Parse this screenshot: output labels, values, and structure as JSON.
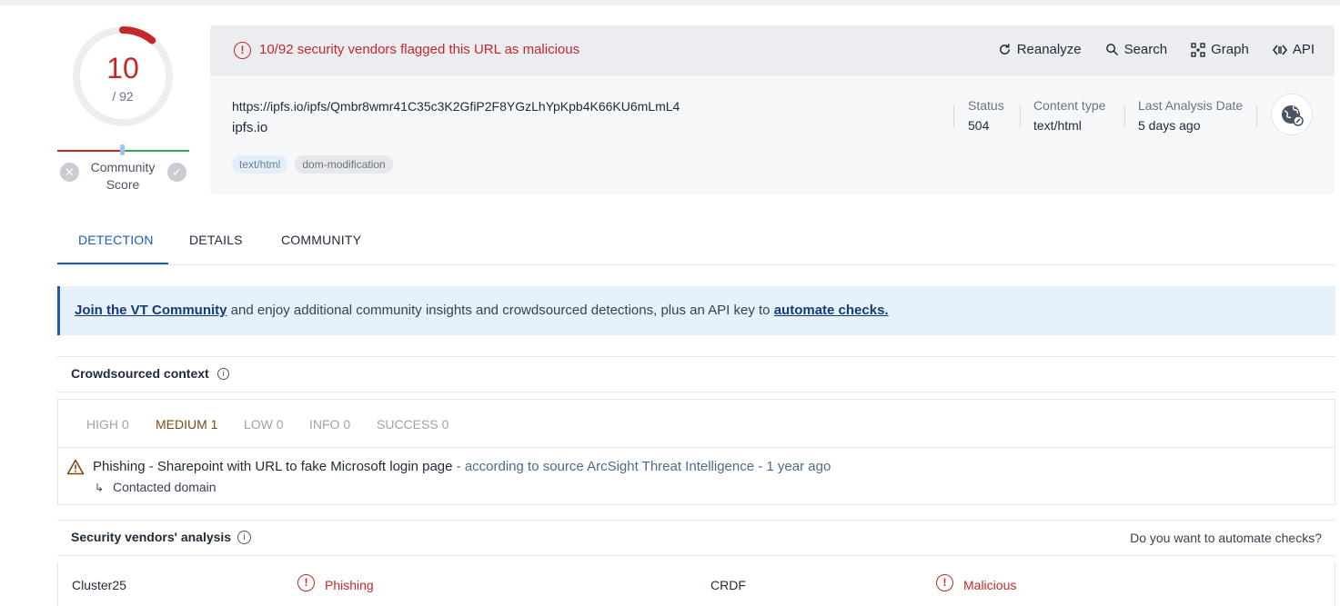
{
  "score": {
    "detections": "10",
    "total": "/ 92",
    "ratio": 0.1087
  },
  "community": {
    "label_line1": "Community",
    "label_line2": "Score"
  },
  "alert": {
    "text": "10/92 security vendors flagged this URL as malicious"
  },
  "actions": {
    "reanalyze": "Reanalyze",
    "search": "Search",
    "graph": "Graph",
    "api": "API"
  },
  "target": {
    "url": "https://ipfs.io/ipfs/Qmbr8wmr41C35c3K2GfiP2F8YGzLhYpKpb4K66KU6mLmL4",
    "host": "ipfs.io",
    "tags": [
      "text/html",
      "dom-modification"
    ]
  },
  "meta": {
    "status_label": "Status",
    "status_value": "504",
    "content_type_label": "Content type",
    "content_type_value": "text/html",
    "last_analysis_label": "Last Analysis Date",
    "last_analysis_value": "5 days ago"
  },
  "tabs": {
    "detection": "DETECTION",
    "details": "DETAILS",
    "community": "COMMUNITY"
  },
  "banner": {
    "link1": "Join the VT Community",
    "middle": " and enjoy additional community insights and crowdsourced detections, plus an API key to ",
    "link2": "automate checks."
  },
  "crowdsourced": {
    "title": "Crowdsourced context",
    "severities": {
      "high": "HIGH 0",
      "medium": "MEDIUM 1",
      "low": "LOW 0",
      "info": "INFO 0",
      "success": "SUCCESS 0"
    },
    "finding": {
      "title": "Phishing - Sharepoint with URL to fake Microsoft login page",
      "source": " - according to source ArcSight Threat Intelligence - 1 year ago",
      "sub": "Contacted domain"
    }
  },
  "vendors": {
    "title": "Security vendors' analysis",
    "automate_prompt": "Do you want to automate checks?",
    "rows": [
      {
        "vendor1": "Cluster25",
        "result1": "Phishing",
        "vendor2": "CRDF",
        "result2": "Malicious"
      }
    ]
  },
  "colors": {
    "malicious": "#c62828",
    "accent": "#1e5bb8",
    "clean": "#34a853"
  }
}
